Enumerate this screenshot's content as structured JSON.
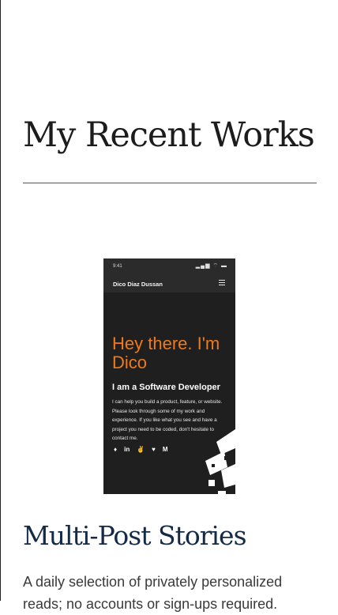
{
  "section": {
    "title": "My Recent Works"
  },
  "preview": {
    "status_time": "9:41",
    "status_icons": "▂▄▆ ⌔ ▬",
    "app_name": "Dico Diaz Dussan",
    "greeting": "Hey there. I'm Dico",
    "role": "I am a Software Developer",
    "description": "I can help you build a product, feature, or website. Please look through some of my work and experience. If you like what you see and have a project you need to be coded, don't hesitate to contact me.",
    "social_icons": [
      "github-icon",
      "linkedin-icon",
      "angellist-icon",
      "twitter-icon",
      "medium-icon"
    ],
    "social_glyphs": [
      "♦",
      "in",
      "✌",
      "♥",
      "M"
    ],
    "accent_color": "#f07a1a"
  },
  "project": {
    "title": "Multi-Post Stories",
    "description": "A daily selection of privately personalized reads; no accounts or sign-ups required."
  }
}
